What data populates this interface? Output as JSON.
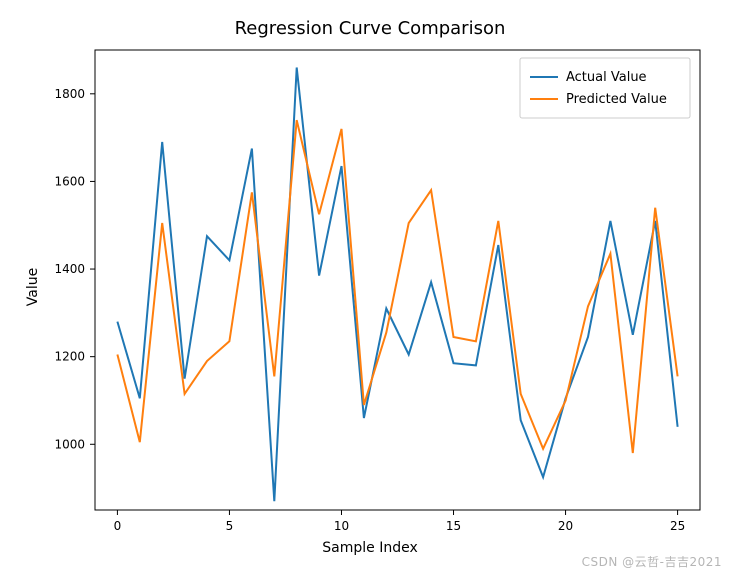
{
  "chart_data": {
    "type": "line",
    "title": "Regression Curve Comparison",
    "xlabel": "Sample Index",
    "ylabel": "Value",
    "xlim": [
      -1,
      26
    ],
    "ylim": [
      850,
      1900
    ],
    "xticks": [
      0,
      5,
      10,
      15,
      20,
      25
    ],
    "yticks": [
      1000,
      1200,
      1400,
      1600,
      1800
    ],
    "x": [
      0,
      1,
      2,
      3,
      4,
      5,
      6,
      7,
      8,
      9,
      10,
      11,
      12,
      13,
      14,
      15,
      16,
      17,
      18,
      19,
      20,
      21,
      22,
      23,
      24,
      25
    ],
    "series": [
      {
        "name": "Actual Value",
        "color": "#1f77b4",
        "values": [
          1280,
          1105,
          1690,
          1150,
          1475,
          1420,
          1675,
          870,
          1860,
          1385,
          1635,
          1060,
          1310,
          1205,
          1370,
          1185,
          1180,
          1455,
          1055,
          925,
          1105,
          1245,
          1510,
          1250,
          1510,
          1040
        ]
      },
      {
        "name": "Predicted Value",
        "color": "#ff7f0e",
        "values": [
          1205,
          1005,
          1505,
          1115,
          1190,
          1235,
          1575,
          1155,
          1740,
          1525,
          1720,
          1090,
          1255,
          1505,
          1580,
          1245,
          1235,
          1510,
          1115,
          990,
          1100,
          1315,
          1435,
          980,
          1540,
          1155
        ]
      }
    ],
    "legend_position": "upper-right"
  },
  "watermark": "CSDN @云哲-吉吉2021"
}
